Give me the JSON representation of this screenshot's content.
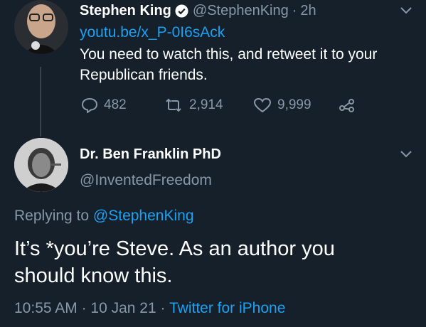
{
  "parent_tweet": {
    "author_name": "Stephen King",
    "handle": "@StephenKing",
    "separator": "·",
    "time": "2h",
    "link_text": "youtu.be/x_P-0I6sAck",
    "text_line1": "You need to watch this, and retweet it to your",
    "text_line2": "Republican friends.",
    "reply_count": "482",
    "retweet_count": "2,914",
    "like_count": "9,999"
  },
  "reply_tweet": {
    "author_name": "Dr. Ben Franklin PhD",
    "handle": "@InventedFreedom",
    "replying_prefix": "Replying to",
    "replying_to": "@StephenKing",
    "text_line1": "It’s *you’re Steve. As an author you",
    "text_line2": "should know this.",
    "time": "10:55 AM",
    "date": "10 Jan 21",
    "separator": "·",
    "client": "Twitter for iPhone"
  },
  "colors": {
    "background": "#15202b",
    "accent": "#1da1f2",
    "muted": "#8899a6"
  },
  "icons": [
    "verified-icon",
    "chevron-down-icon",
    "reply-icon",
    "retweet-icon",
    "like-icon",
    "share-icon"
  ]
}
